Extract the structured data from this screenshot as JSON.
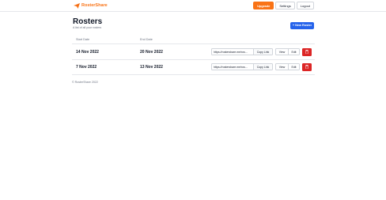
{
  "header": {
    "brand_name": "RosterShare",
    "brand_icon": "paper-plane-icon",
    "nav": {
      "upgrade_label": "Upgrade",
      "settings_label": "Settings",
      "logout_label": "Logout"
    }
  },
  "page": {
    "title": "Rosters",
    "subtitle": "A list of all your rosters",
    "new_button_label": "+ New Roster"
  },
  "table": {
    "columns": [
      "Start Date",
      "End Date"
    ],
    "rows": [
      {
        "start_date": "14 Nov 2022",
        "end_date": "20 Nov 2022",
        "share_link": "https://rostershare.me/ros...",
        "copy_label": "Copy Link",
        "view_label": "View",
        "edit_label": "Edit",
        "delete_icon": "trash-icon"
      },
      {
        "start_date": "7 Nov 2022",
        "end_date": "13 Nov 2022",
        "share_link": "https://rostershare.me/ros...",
        "copy_label": "Copy Link",
        "view_label": "View",
        "edit_label": "Edit",
        "delete_icon": "trash-icon"
      }
    ]
  },
  "footer": {
    "copyright": "© RosterShare 2022"
  },
  "colors": {
    "brand": "#f97316",
    "primary": "#2563eb",
    "danger": "#dc2626",
    "muted_text": "#6b7280",
    "border": "#e5e7eb"
  }
}
